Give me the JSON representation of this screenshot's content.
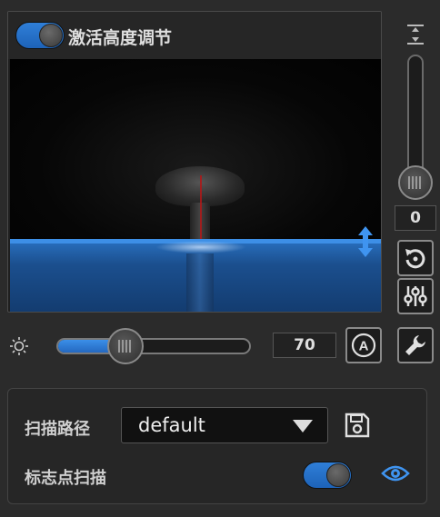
{
  "preview": {
    "header_title": "激活高度调节",
    "activate_toggle_on": true
  },
  "height_slider": {
    "value": "0",
    "icon": "fit-height-icon"
  },
  "brightness": {
    "icon": "sun-icon",
    "value": "70",
    "level_percent": 35
  },
  "tool_buttons": {
    "reset_icon": "reset-icon",
    "mixer_icon": "mixer-icon",
    "auto_icon": "auto-icon",
    "wrench_icon": "wrench-icon",
    "auto_label": "A"
  },
  "scan_panel": {
    "path_label": "扫描路径",
    "path_value": "default",
    "marker_label": "标志点扫描",
    "marker_toggle_on": true
  },
  "colors": {
    "accent": "#2f7fd8",
    "background": "#2b2b2b"
  }
}
